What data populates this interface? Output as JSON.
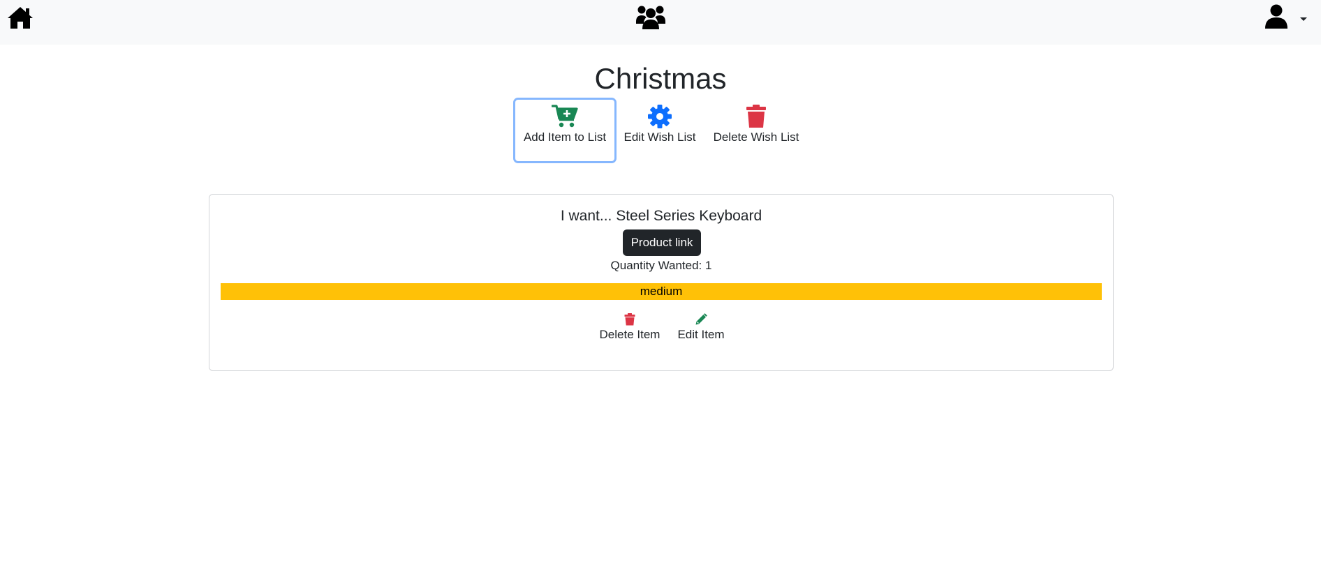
{
  "navbar": {
    "home_icon": "home-icon",
    "groups_icon": "users-icon",
    "user_icon": "user-icon",
    "dropdown_icon": "caret-down-icon"
  },
  "page": {
    "title": "Christmas"
  },
  "actions": {
    "add_item_label": "Add Item to List",
    "add_item_icon": "cart-plus-icon",
    "edit_list_label": "Edit Wish List",
    "edit_list_icon": "gear-icon",
    "delete_list_label": "Delete Wish List",
    "delete_list_icon": "trash-icon"
  },
  "item": {
    "title": "I want... Steel Series Keyboard",
    "product_link_label": "Product link",
    "quantity_text": "Quantity Wanted: 1",
    "priority": "medium",
    "delete_label": "Delete Item",
    "edit_label": "Edit Item"
  },
  "colors": {
    "navbar_bg": "#f8f9fa",
    "success": "#198754",
    "primary": "#0d6efd",
    "danger": "#dc3545",
    "warning": "#ffc107",
    "dark": "#212529",
    "focus_ring": "#86b7fe"
  }
}
